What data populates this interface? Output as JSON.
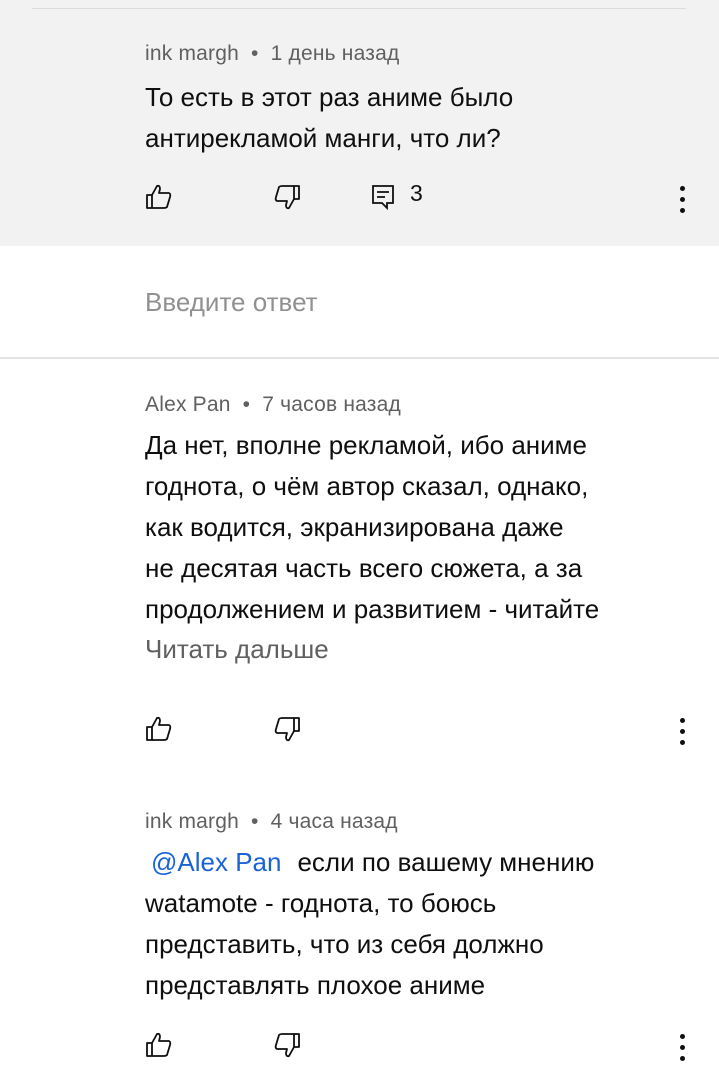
{
  "parent_comment": {
    "author": "ink margh",
    "separator": "•",
    "time": "1 день назад",
    "lines": [
      "То есть в этот раз аниме было",
      "антирекламой манги, что ли?"
    ],
    "reply_count": "3"
  },
  "reply_input": {
    "placeholder": "Введите ответ"
  },
  "replies": [
    {
      "author": "Alex Pan",
      "separator": "•",
      "time": "7 часов назад",
      "lines": [
        "Да нет, вполне рекламой, ибо аниме",
        "годнота, о чём автор сказал, однако,",
        "как водится, экранизирована даже",
        "не десятая часть всего сюжета, а за",
        "продолжением и развитием - читайте"
      ],
      "read_more": "Читать дальше"
    },
    {
      "author": "ink margh",
      "separator": "•",
      "time": "4 часа назад",
      "mention": "@Alex Pan",
      "lines": [
        "если по вашему мнению",
        "watamote - годнота, то боюсь",
        "представить, что из себя должно",
        "представлять плохое аниме"
      ]
    }
  ],
  "colors": {
    "parent_background": "#f2f2f2",
    "mention": "#1a63d6",
    "secondary_text": "#606060"
  },
  "icons": {
    "like": "thumbs-up-outline",
    "dislike": "thumbs-down-outline",
    "replies": "comment-list",
    "more": "vertical-dots"
  }
}
